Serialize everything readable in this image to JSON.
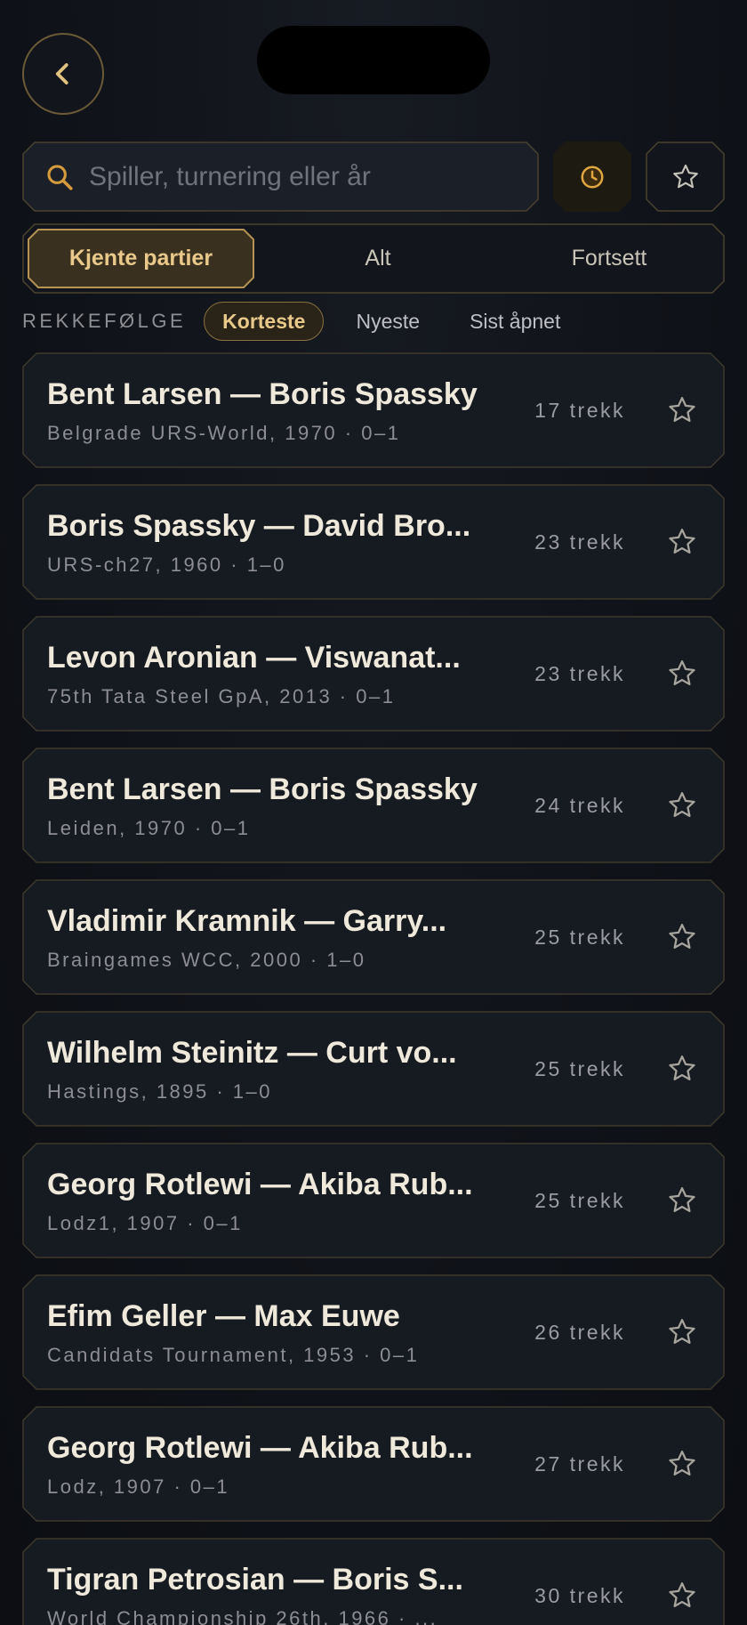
{
  "search": {
    "placeholder": "Spiller, turnering eller år",
    "value": ""
  },
  "tabs": [
    {
      "label": "Kjente partier",
      "active": true
    },
    {
      "label": "Alt",
      "active": false
    },
    {
      "label": "Fortsett",
      "active": false
    }
  ],
  "sort": {
    "label": "REKKEFØLGE",
    "options": [
      {
        "label": "Korteste",
        "active": true
      },
      {
        "label": "Nyeste",
        "active": false
      },
      {
        "label": "Sist åpnet",
        "active": false
      }
    ]
  },
  "games": [
    {
      "title": "Bent Larsen — Boris Spassky",
      "subtitle": "Belgrade URS-World, 1970 · 0–1",
      "moves": "17 trekk"
    },
    {
      "title": "Boris Spassky — David Bro...",
      "subtitle": "URS-ch27, 1960 · 1–0",
      "moves": "23 trekk"
    },
    {
      "title": "Levon Aronian — Viswanat...",
      "subtitle": "75th Tata Steel GpA, 2013 · 0–1",
      "moves": "23 trekk"
    },
    {
      "title": "Bent Larsen — Boris Spassky",
      "subtitle": "Leiden, 1970 · 0–1",
      "moves": "24 trekk"
    },
    {
      "title": "Vladimir Kramnik — Garry...",
      "subtitle": "Braingames WCC, 2000 · 1–0",
      "moves": "25 trekk"
    },
    {
      "title": "Wilhelm Steinitz — Curt vo...",
      "subtitle": "Hastings, 1895 · 1–0",
      "moves": "25 trekk"
    },
    {
      "title": "Georg Rotlewi — Akiba Rub...",
      "subtitle": "Lodz1, 1907 · 0–1",
      "moves": "25 trekk"
    },
    {
      "title": "Efim Geller — Max Euwe",
      "subtitle": "Candidats Tournament, 1953 · 0–1",
      "moves": "26 trekk"
    },
    {
      "title": "Georg Rotlewi — Akiba Rub...",
      "subtitle": "Lodz, 1907 · 0–1",
      "moves": "27 trekk"
    },
    {
      "title": "Tigran Petrosian — Boris S...",
      "subtitle": "World Championship 26th, 1966 · ...",
      "moves": "30 trekk"
    }
  ],
  "colors": {
    "accent": "#e9c98a",
    "border": "#3b3627",
    "card": "#161a21"
  }
}
